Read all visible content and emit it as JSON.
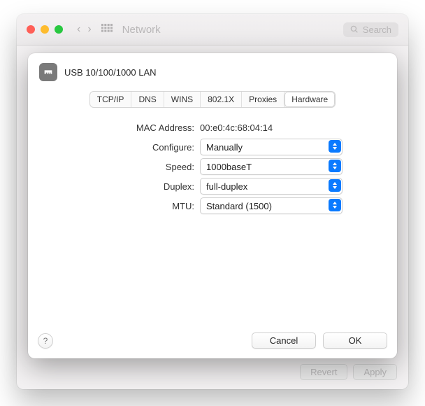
{
  "window": {
    "title": "Network",
    "search_placeholder": "Search"
  },
  "bg_buttons": {
    "revert": "Revert",
    "apply": "Apply"
  },
  "sheet": {
    "interface_name": "USB 10/100/1000 LAN",
    "tabs": [
      "TCP/IP",
      "DNS",
      "WINS",
      "802.1X",
      "Proxies",
      "Hardware"
    ],
    "active_tab": "Hardware",
    "fields": {
      "mac_label": "MAC Address:",
      "mac_value": "00:e0:4c:68:04:14",
      "configure_label": "Configure:",
      "configure_value": "Manually",
      "speed_label": "Speed:",
      "speed_value": "1000baseT",
      "duplex_label": "Duplex:",
      "duplex_value": "full-duplex",
      "mtu_label": "MTU:",
      "mtu_value": "Standard (1500)"
    },
    "footer": {
      "help": "?",
      "cancel": "Cancel",
      "ok": "OK"
    }
  }
}
